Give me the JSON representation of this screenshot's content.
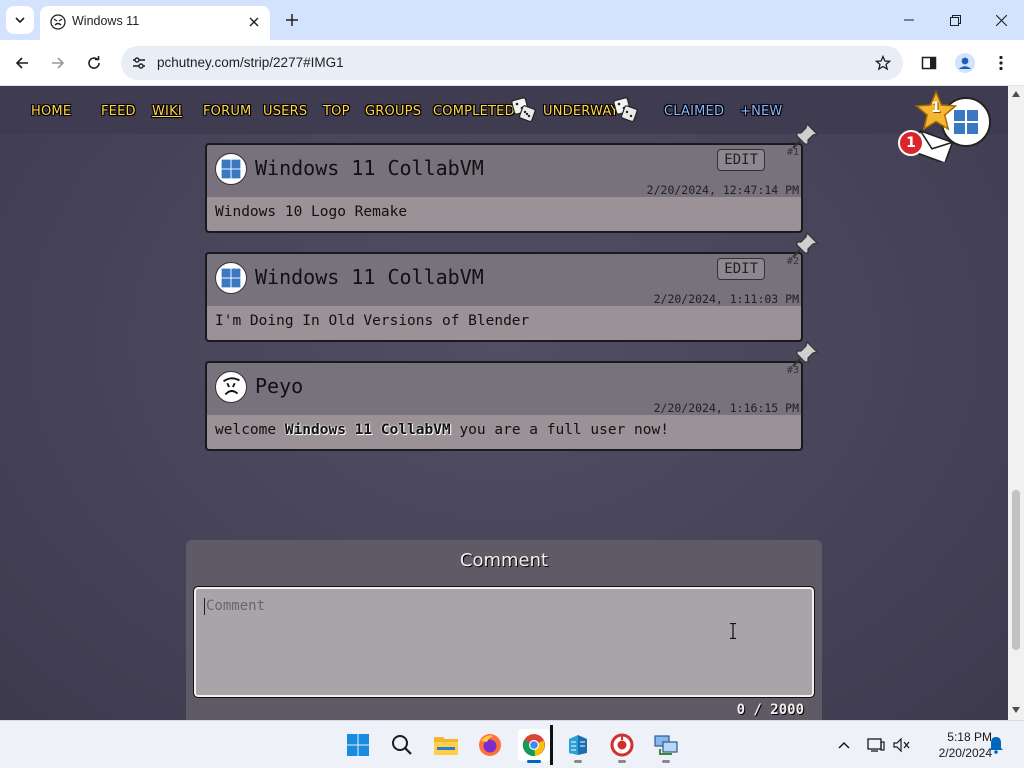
{
  "browser": {
    "tab_title": "Windows 11",
    "url": "pchutney.com/strip/2277#IMG1"
  },
  "site_nav": {
    "items": [
      {
        "label": "HOME"
      },
      {
        "label": "FEED"
      },
      {
        "label": "WIKI"
      },
      {
        "label": "FORUM"
      },
      {
        "label": "USERS"
      },
      {
        "label": "TOP"
      },
      {
        "label": "GROUPS"
      },
      {
        "label": "COMPLETED"
      },
      {
        "label": "UNDERWAY"
      },
      {
        "label": "CLAIMED"
      },
      {
        "label": "+NEW"
      }
    ],
    "notification_count": "1",
    "star_count": "1"
  },
  "comments": [
    {
      "author": "Windows 11 CollabVM",
      "timestamp": "2/20/2024, 12:47:14 PM",
      "number": "#1",
      "edit_label": "EDIT",
      "body": "Windows 10 Logo Remake"
    },
    {
      "author": "Windows 11 CollabVM",
      "timestamp": "2/20/2024, 1:11:03 PM",
      "number": "#2",
      "edit_label": "EDIT",
      "body": "I'm Doing In Old Versions of Blender"
    },
    {
      "author": "Peyo",
      "timestamp": "2/20/2024, 1:16:15 PM",
      "number": "#3",
      "body_prefix": "welcome ",
      "body_mention": "Windows 11 CollabVM",
      "body_suffix": " you are a full user now!"
    }
  ],
  "comment_form": {
    "heading": "Comment",
    "placeholder": "Comment",
    "char_count": "0 / 2000"
  },
  "taskbar": {
    "apps": [
      "start",
      "search",
      "file-explorer",
      "firefox",
      "chrome",
      "app-blue",
      "app-red",
      "app-network"
    ],
    "clock_time": "5:18 PM",
    "clock_date": "2/20/2024"
  }
}
